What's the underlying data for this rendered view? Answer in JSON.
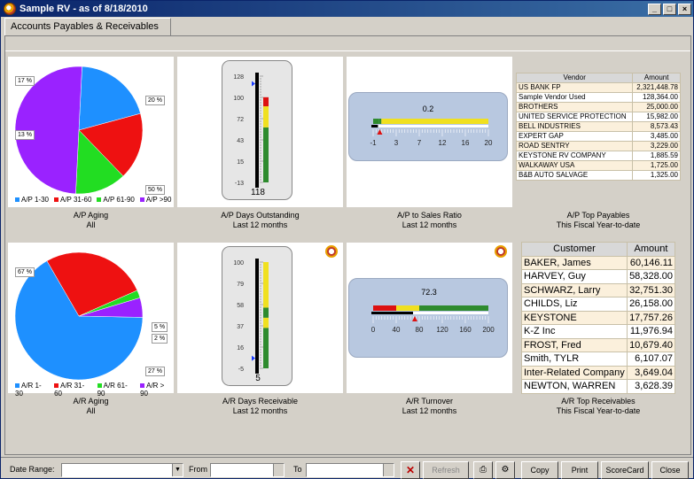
{
  "window": {
    "title": "Sample RV - as of 8/18/2010",
    "min": "_",
    "max": "□",
    "close": "×"
  },
  "tab": {
    "label": "Accounts Payables & Receivables"
  },
  "ap_aging": {
    "caption1": "A/P Aging",
    "caption2": "All",
    "legend": [
      "A/P 1-30",
      "A/P 31-60",
      "A/P 61-90",
      "A/P >90"
    ],
    "labels": [
      "20 %",
      "17 %",
      "13 %",
      "50 %"
    ],
    "chart_data": {
      "type": "pie",
      "categories": [
        "A/P 1-30",
        "A/P 31-60",
        "A/P 61-90",
        "A/P >90"
      ],
      "values": [
        20,
        17,
        13,
        50
      ],
      "colors": [
        "#1e90ff",
        "#ee1111",
        "#22dd22",
        "#9a22ff"
      ]
    }
  },
  "ap_days": {
    "caption1": "A/P Days Outstanding",
    "caption2": "Last 12 months",
    "ticks": [
      "128",
      "100",
      "72",
      "43",
      "15",
      "-13"
    ],
    "value": "118",
    "chart_data": {
      "type": "bar",
      "min": -13,
      "max": 128,
      "value": 118,
      "bands": [
        {
          "from": -13,
          "to": 60,
          "color": "#2e8b2e"
        },
        {
          "from": 60,
          "to": 88,
          "color": "#f0e020"
        },
        {
          "from": 88,
          "to": 100,
          "color": "#dd1111"
        }
      ]
    }
  },
  "ap_ratio": {
    "caption1": "A/P to Sales Ratio",
    "caption2": "Last 12 months",
    "value": "0.2",
    "ticks": [
      "-1",
      "3",
      "7",
      "12",
      "16",
      "20"
    ],
    "chart_data": {
      "type": "bar",
      "min": -1,
      "max": 20,
      "value": 0.2,
      "bands": [
        {
          "from": -1,
          "to": 0,
          "color": "#2e8b2e"
        },
        {
          "from": 0,
          "to": 0.5,
          "color": "#2e8b2e"
        },
        {
          "from": 0.5,
          "to": 20,
          "color": "#f0e020"
        }
      ]
    }
  },
  "ap_top": {
    "caption1": "A/P Top Payables",
    "caption2": "This Fiscal Year-to-date",
    "headers": [
      "Vendor",
      "Amount"
    ],
    "rows": [
      [
        "US BANK FP",
        "2,321,448.78"
      ],
      [
        "Sample Vendor Used",
        "128,364.00"
      ],
      [
        "BROTHERS",
        "25,000.00"
      ],
      [
        "UNITED SERVICE PROTECTION",
        "15,982.00"
      ],
      [
        "BELL INDUSTRIES",
        "8,573.43"
      ],
      [
        "EXPERT GAP",
        "3,485.00"
      ],
      [
        "ROAD SENTRY",
        "3,229.00"
      ],
      [
        "KEYSTONE RV COMPANY",
        "1,885.59"
      ],
      [
        "WALKAWAY USA",
        "1,725.00"
      ],
      [
        "B&B AUTO SALVAGE",
        "1,325.00"
      ]
    ]
  },
  "ar_aging": {
    "caption1": "A/R Aging",
    "caption2": "All",
    "legend": [
      "A/R 1-30",
      "A/R 31-60",
      "A/R 61-90",
      "A/R > 90"
    ],
    "labels": [
      "67 %",
      "27 %",
      "2 %",
      "5 %"
    ],
    "chart_data": {
      "type": "pie",
      "categories": [
        "A/R 1-30",
        "A/R 31-60",
        "A/R 61-90",
        "A/R > 90"
      ],
      "values": [
        67,
        27,
        2,
        5
      ],
      "colors": [
        "#1e90ff",
        "#ee1111",
        "#22dd22",
        "#9a22ff"
      ]
    }
  },
  "ar_days": {
    "caption1": "A/R Days Receivable",
    "caption2": "Last 12 months",
    "ticks": [
      "100",
      "79",
      "58",
      "37",
      "16",
      "-5"
    ],
    "value": "5",
    "chart_data": {
      "type": "bar",
      "min": -5,
      "max": 100,
      "value": 5,
      "bands": [
        {
          "from": -5,
          "to": 35,
          "color": "#2e8b2e"
        },
        {
          "from": 35,
          "to": 45,
          "color": "#f0e020"
        },
        {
          "from": 45,
          "to": 55,
          "color": "#2e8b2e"
        },
        {
          "from": 55,
          "to": 100,
          "color": "#f0e020"
        }
      ]
    }
  },
  "ar_turnover": {
    "caption1": "A/R Turnover",
    "caption2": "Last 12 months",
    "value": "72.3",
    "ticks": [
      "0",
      "40",
      "80",
      "120",
      "160",
      "200"
    ],
    "chart_data": {
      "type": "bar",
      "min": 0,
      "max": 200,
      "value": 72.3,
      "bands": [
        {
          "from": 0,
          "to": 40,
          "color": "#dd1111"
        },
        {
          "from": 40,
          "to": 80,
          "color": "#f0e020"
        },
        {
          "from": 80,
          "to": 120,
          "color": "#2e8b2e"
        },
        {
          "from": 120,
          "to": 200,
          "color": "#2e8b2e"
        }
      ]
    }
  },
  "ar_top": {
    "caption1": "A/R Top Receivables",
    "caption2": "This Fiscal Year-to-date",
    "headers": [
      "Customer",
      "Amount"
    ],
    "rows": [
      [
        "BAKER, James",
        "60,146.11"
      ],
      [
        "HARVEY, Guy",
        "58,328.00"
      ],
      [
        "SCHWARZ, Larry",
        "32,751.30"
      ],
      [
        "CHILDS, Liz",
        "26,158.00"
      ],
      [
        "KEYSTONE",
        "17,757.26"
      ],
      [
        "K-Z Inc",
        "11,976.94"
      ],
      [
        "FROST, Fred",
        "10,679.40"
      ],
      [
        "Smith, TYLR",
        "6,107.07"
      ],
      [
        "Inter-Related Company",
        "3,649.04"
      ],
      [
        "NEWTON, WARREN",
        "3,628.39"
      ]
    ]
  },
  "bottom": {
    "date_range": "Date Range:",
    "from": "From",
    "to": "To",
    "refresh": "Refresh",
    "copy": "Copy",
    "print": "Print",
    "scorecard": "ScoreCard",
    "close": "Close"
  }
}
